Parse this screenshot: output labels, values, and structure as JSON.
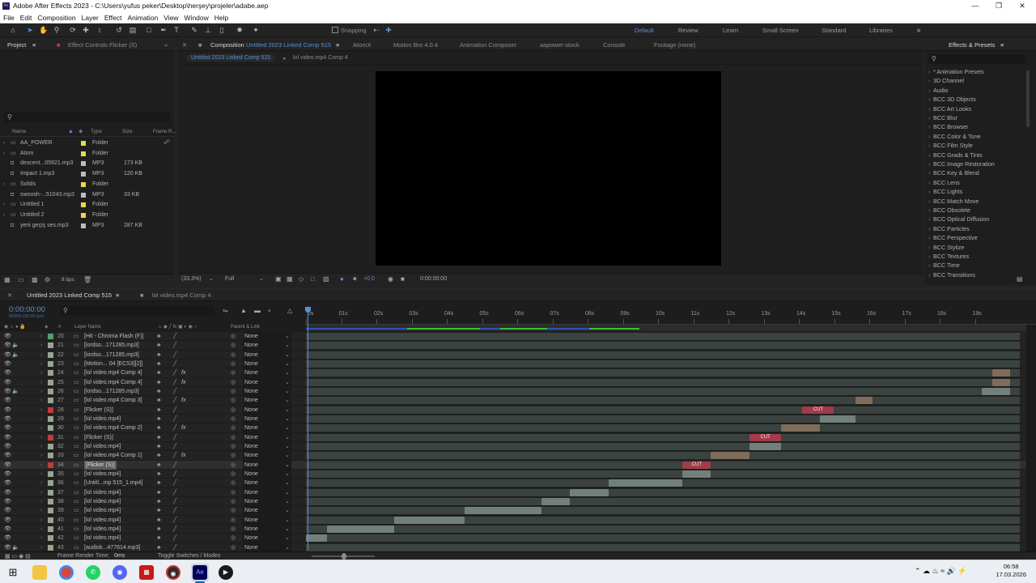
{
  "window": {
    "title": "Adobe After Effects 2023 - C:\\Users\\yufus peker\\Desktop\\herşey\\projeler\\adabe.aep"
  },
  "menu": [
    "File",
    "Edit",
    "Composition",
    "Layer",
    "Effect",
    "Animation",
    "View",
    "Window",
    "Help"
  ],
  "toolbar": {
    "snapping_label": "Snapping",
    "workspaces": [
      "Default",
      "Review",
      "Learn",
      "Small Screen",
      "Standard",
      "Libraries"
    ]
  },
  "project": {
    "tab_project": "Project",
    "tab_effect_controls": "Effect Controls Flicker (S)",
    "columns": {
      "name": "Name",
      "type": "Type",
      "size": "Size",
      "frame_rate": "Frame R..."
    },
    "items": [
      {
        "name": "AA_POWER",
        "type": "Folder",
        "size": "",
        "color": "#e6d84a",
        "icon": "folder-icon"
      },
      {
        "name": "Atom",
        "type": "Folder",
        "size": "",
        "color": "#e6d84a",
        "icon": "folder-icon"
      },
      {
        "name": "descent...05921.mp3",
        "type": "MP3",
        "size": "173 KB",
        "color": "#bdbdbd",
        "icon": "audio-file-icon"
      },
      {
        "name": "Impact 1.mp3",
        "type": "MP3",
        "size": "120 KB",
        "color": "#bdbdbd",
        "icon": "audio-file-icon"
      },
      {
        "name": "Solids",
        "type": "Folder",
        "size": "",
        "color": "#e6d84a",
        "icon": "folder-icon"
      },
      {
        "name": "swoosh-...51043.mp3",
        "type": "MP3",
        "size": "33 KB",
        "color": "#bdbdbd",
        "icon": "audio-file-icon"
      },
      {
        "name": "Untitled 1",
        "type": "Folder",
        "size": "",
        "color": "#e6d84a",
        "icon": "folder-icon"
      },
      {
        "name": "Untitled 2",
        "type": "Folder",
        "size": "",
        "color": "#e6d84a",
        "icon": "folder-icon"
      },
      {
        "name": "yeni geçiş ses.mp3",
        "type": "MP3",
        "size": "287 KB",
        "color": "#bdbdbd",
        "icon": "audio-file-icon"
      }
    ],
    "bpc": "8 bpc"
  },
  "composition": {
    "tab_label": "Composition",
    "comp_name": "Untitled 2023 Linked Comp 515",
    "other_tabs": [
      "AtomX",
      "Motion Bro 4.0.4",
      "Animation Composer",
      "aapower-stock",
      "Console",
      "Footage (none)"
    ],
    "sub_tabs": [
      "Untitled 2023 Linked Comp 515",
      "lol video.mp4 Comp 4"
    ],
    "zoom": "(33,3%)",
    "resolution": "Full",
    "exposure": "+0,0",
    "time": "0:00:00:00"
  },
  "effects": {
    "title": "Effects & Presets",
    "items": [
      "* Animation Presets",
      "3D Channel",
      "Audio",
      "BCC 3D Objects",
      "BCC Art Looks",
      "BCC Blur",
      "BCC Browser",
      "BCC Color & Tone",
      "BCC Film Style",
      "BCC Grads & Tints",
      "BCC Image Restoration",
      "BCC Key & Blend",
      "BCC Lens",
      "BCC Lights",
      "BCC Match Move",
      "BCC Obsolete",
      "BCC Optical Diffusion",
      "BCC Particles",
      "BCC Perspective",
      "BCC Stylize",
      "BCC Textures",
      "BCC Time",
      "BCC Transitions"
    ]
  },
  "timeline": {
    "tabs": [
      "Untitled 2023 Linked Comp 515",
      "lol video.mp4 Comp 4"
    ],
    "timecode": "0:00:00:00",
    "subtimecode": "00000 (30.00 fps)",
    "col_layer_name": "Layer Name",
    "col_parent": "Parent & Link",
    "ruler": [
      "0s",
      "01s",
      "02s",
      "03s",
      "04s",
      "05s",
      "06s",
      "07s",
      "08s",
      "09s",
      "10s",
      "11s",
      "12s",
      "13s",
      "14s",
      "15s",
      "16s",
      "17s",
      "18s",
      "19s"
    ],
    "duration_s": 20,
    "frame_render_label": "Frame Render Time:",
    "frame_render_value": "0ms",
    "toggle_label": "Toggle Switches / Modes",
    "cut_label": "CUT",
    "layers": [
      {
        "num": "20",
        "name": "[Hit - Chroma Flash (F)]",
        "color": "#4aa56b",
        "parent": "None",
        "audio": false,
        "fx": false,
        "bar": null
      },
      {
        "num": "21",
        "name": "[lordso...171285.mp3]",
        "color": "#9aa48f",
        "parent": "None",
        "audio": true,
        "fx": false,
        "bar": null
      },
      {
        "num": "22",
        "name": "[lordso...171285.mp3]",
        "color": "#9aa48f",
        "parent": "None",
        "audio": true,
        "fx": false,
        "bar": null
      },
      {
        "num": "23",
        "name": "[Motion... 04 [ECS3][2]]",
        "color": "#9aa48f",
        "parent": "None",
        "audio": false,
        "fx": false,
        "bar": null
      },
      {
        "num": "24",
        "name": "[lol video.mp4 Comp 4]",
        "color": "#9aa48f",
        "parent": "None",
        "audio": false,
        "fx": true,
        "bar": [
          19.5,
          20
        ]
      },
      {
        "num": "25",
        "name": "[lol video.mp4 Comp 4]",
        "color": "#9aa48f",
        "parent": "None",
        "audio": false,
        "fx": true,
        "bar": [
          19.5,
          20
        ]
      },
      {
        "num": "26",
        "name": "[lordso...171285.mp3]",
        "color": "#9aa48f",
        "parent": "None",
        "audio": true,
        "fx": false,
        "bar": [
          19.2,
          20
        ]
      },
      {
        "num": "27",
        "name": "[lol video.mp4 Comp 3]",
        "color": "#9aa48f",
        "parent": "None",
        "audio": false,
        "fx": true,
        "bar": [
          15.6,
          16.1
        ]
      },
      {
        "num": "28",
        "name": "[Flicker (S)]",
        "color": "#c23a3a",
        "parent": "None",
        "audio": false,
        "fx": false,
        "bar": null,
        "cut": [
          14.1,
          15.0
        ]
      },
      {
        "num": "29",
        "name": "[lol video.mp4]",
        "color": "#9aa48f",
        "parent": "None",
        "audio": false,
        "fx": false,
        "bar": [
          14.6,
          15.6
        ]
      },
      {
        "num": "30",
        "name": "[lol video.mp4 Comp 2]",
        "color": "#9aa48f",
        "parent": "None",
        "audio": false,
        "fx": true,
        "bar": [
          13.5,
          14.6
        ]
      },
      {
        "num": "31",
        "name": "[Flicker (S)]",
        "color": "#c23a3a",
        "parent": "None",
        "audio": false,
        "fx": false,
        "bar": null,
        "cut": [
          12.6,
          13.5
        ]
      },
      {
        "num": "32",
        "name": "[lol video.mp4]",
        "color": "#9aa48f",
        "parent": "None",
        "audio": false,
        "fx": false,
        "bar": [
          12.6,
          13.5
        ]
      },
      {
        "num": "33",
        "name": "[lol video.mp4 Comp 1]",
        "color": "#9aa48f",
        "parent": "None",
        "audio": false,
        "fx": true,
        "bar": [
          11.5,
          12.6
        ]
      },
      {
        "num": "34",
        "name": "[Flicker (S)]",
        "color": "#c23a3a",
        "parent": "None",
        "audio": false,
        "fx": false,
        "bar": null,
        "cut": [
          10.7,
          11.5
        ],
        "selected": true
      },
      {
        "num": "35",
        "name": "[lol video.mp4]",
        "color": "#9aa48f",
        "parent": "None",
        "audio": false,
        "fx": false,
        "bar": [
          10.7,
          11.5
        ]
      },
      {
        "num": "36",
        "name": "[Untitl...mp 515_1.mp4]",
        "color": "#9aa48f",
        "parent": "None",
        "audio": false,
        "fx": false,
        "bar": [
          8.6,
          10.7
        ]
      },
      {
        "num": "37",
        "name": "[lol video.mp4]",
        "color": "#9aa48f",
        "parent": "None",
        "audio": false,
        "fx": false,
        "bar": [
          7.5,
          8.6
        ]
      },
      {
        "num": "38",
        "name": "[lol video.mp4]",
        "color": "#9aa48f",
        "parent": "None",
        "audio": false,
        "fx": false,
        "bar": [
          6.7,
          7.5
        ]
      },
      {
        "num": "39",
        "name": "[lol video.mp4]",
        "color": "#9aa48f",
        "parent": "None",
        "audio": false,
        "fx": false,
        "bar": [
          4.5,
          6.7
        ]
      },
      {
        "num": "40",
        "name": "[lol video.mp4]",
        "color": "#9aa48f",
        "parent": "None",
        "audio": false,
        "fx": false,
        "bar": [
          2.5,
          4.5
        ]
      },
      {
        "num": "41",
        "name": "[lol video.mp4]",
        "color": "#9aa48f",
        "parent": "None",
        "audio": false,
        "fx": false,
        "bar": [
          0.6,
          2.5
        ]
      },
      {
        "num": "42",
        "name": "[lol video.mp4]",
        "color": "#9aa48f",
        "parent": "None",
        "audio": false,
        "fx": false,
        "bar": [
          0,
          0.6
        ]
      },
      {
        "num": "43",
        "name": "[audiok...477614.mp3]",
        "color": "#9aa48f",
        "parent": "None",
        "audio": true,
        "fx": false,
        "bar": null
      }
    ]
  },
  "taskbar": {
    "apps": [
      "windows-start-icon",
      "file-explorer-icon",
      "chrome-icon",
      "whatsapp-icon",
      "discord-icon",
      "app-icon",
      "obs-icon",
      "after-effects-icon",
      "media-player-icon"
    ],
    "ae_label": "Ae",
    "time": "06:58",
    "date": "17.03.2026"
  }
}
